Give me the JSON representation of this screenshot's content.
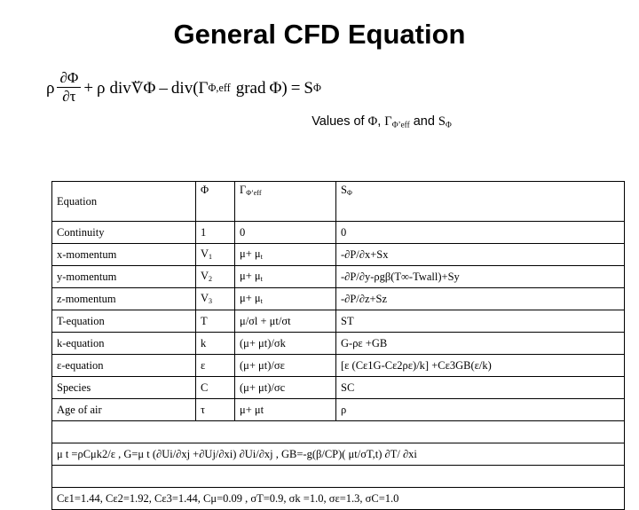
{
  "title": "General CFD Equation",
  "equation": {
    "rho1": "ρ",
    "frac_num": "∂Φ",
    "frac_den": "∂τ",
    "plus": "+",
    "rho2": "ρ",
    "div1": "div",
    "vector": "V",
    "vector_bar": "⎵",
    "phi_after_v": "Φ",
    "minus": "–",
    "div2": "div(",
    "gamma": "Γ",
    "gamma_sub": "Φ,eff",
    "grad": "grad",
    "phi_grad": "Φ)",
    "equals": "=",
    "source": "S",
    "source_sub": "Φ"
  },
  "caption": {
    "text_1": "Values of ",
    "phi": "Φ",
    "comma": ", ",
    "gamma": "Γ",
    "gamma_sub": "Φ’eff",
    "text_2": " and ",
    "s": "S",
    "s_sub": "Φ"
  },
  "table": {
    "headers": {
      "equation": "Equation",
      "phi": "Φ",
      "gamma": "Γ",
      "gamma_sub": "Φ’eff",
      "source": "S",
      "source_sub": "Φ"
    },
    "rows": [
      {
        "equation": "Continuity",
        "phi": "1",
        "gamma": "0",
        "source": "0"
      },
      {
        "equation": "x-momentum",
        "phi_base": "V",
        "phi_sub": "1",
        "gamma": "μ+ μ",
        "gamma_sub": "t",
        "source": "-∂P/∂x+Sx"
      },
      {
        "equation": "y-momentum",
        "phi_base": "V",
        "phi_sub": "2",
        "gamma": "μ+ μ",
        "gamma_sub": "t",
        "source": "-∂P/∂y-ρgβ(T∞-Twall)+Sy"
      },
      {
        "equation": "z-momentum",
        "phi_base": "V",
        "phi_sub": "3",
        "gamma": "μ+ μ",
        "gamma_sub": "t",
        "source": "-∂P/∂z+Sz"
      },
      {
        "equation": "T-equation",
        "phi": "T",
        "gamma": "μ/σl + μt/σt",
        "source": "ST"
      },
      {
        "equation": "k-equation",
        "phi": "k",
        "gamma": "(μ+ μt)/σk",
        "source": "G-ρε +GB"
      },
      {
        "equation": "ε-equation",
        "phi": "ε",
        "gamma": "(μ+ μt)/σε",
        "source": "[ε (Cε1G-Cε2ρε)/k] +Cε3GB(ε/k)"
      },
      {
        "equation": "Species",
        "phi": "C",
        "gamma": "(μ+ μt)/σc",
        "source": "SC"
      },
      {
        "equation": "Age of air",
        "phi": "τ",
        "gamma": "μ+ μt",
        "source": "ρ"
      }
    ],
    "footnotes": {
      "line1": "μ t =ρCμk2/ε , G=μ t (∂Ui/∂xj +∂Uj/∂xi) ∂Ui/∂xj  ,  GB=-g(β/CP)( μt/σT,t) ∂T/ ∂xi",
      "line2": "Cε1=1.44, Cε2=1.92, Cε3=1.44, Cμ=0.09 ,   σT=0.9, σk =1.0, σε=1.3, σC=1.0"
    }
  },
  "colors": {
    "background": "#ffffff",
    "text": "#000000",
    "border": "#000000"
  }
}
